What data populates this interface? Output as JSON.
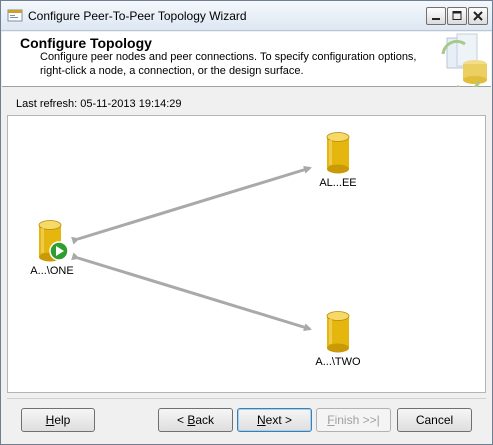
{
  "window": {
    "title": "Configure Peer-To-Peer Topology Wizard"
  },
  "header": {
    "title": "Configure Topology",
    "description": "Configure peer nodes and peer connections. To specify configuration options, right-click a node, a connection, or the design surface."
  },
  "refresh": {
    "label": "Last refresh:",
    "value": "05-11-2013 19:14:29"
  },
  "topology": {
    "nodes": [
      {
        "id": "one",
        "label": "A...\\ONE",
        "publisher": true
      },
      {
        "id": "ee",
        "label": "AL...EE",
        "publisher": false
      },
      {
        "id": "two",
        "label": "A...\\TWO",
        "publisher": false
      }
    ],
    "connections": [
      {
        "from": "one",
        "to": "ee"
      },
      {
        "from": "one",
        "to": "two"
      }
    ],
    "colors": {
      "connection": "#a9a9a9",
      "db_body": "#e5b60e",
      "db_top": "#f7d96a",
      "publisher_badge": "#2f9e2f"
    }
  },
  "buttons": {
    "help": {
      "pre": "",
      "accel": "H",
      "post": "elp"
    },
    "back": {
      "pre": "< ",
      "accel": "B",
      "post": "ack"
    },
    "next": {
      "pre": "",
      "accel": "N",
      "post": "ext >"
    },
    "finish": {
      "pre": "",
      "accel": "F",
      "post": "inish >>|"
    },
    "cancel": {
      "label": "Cancel"
    }
  }
}
